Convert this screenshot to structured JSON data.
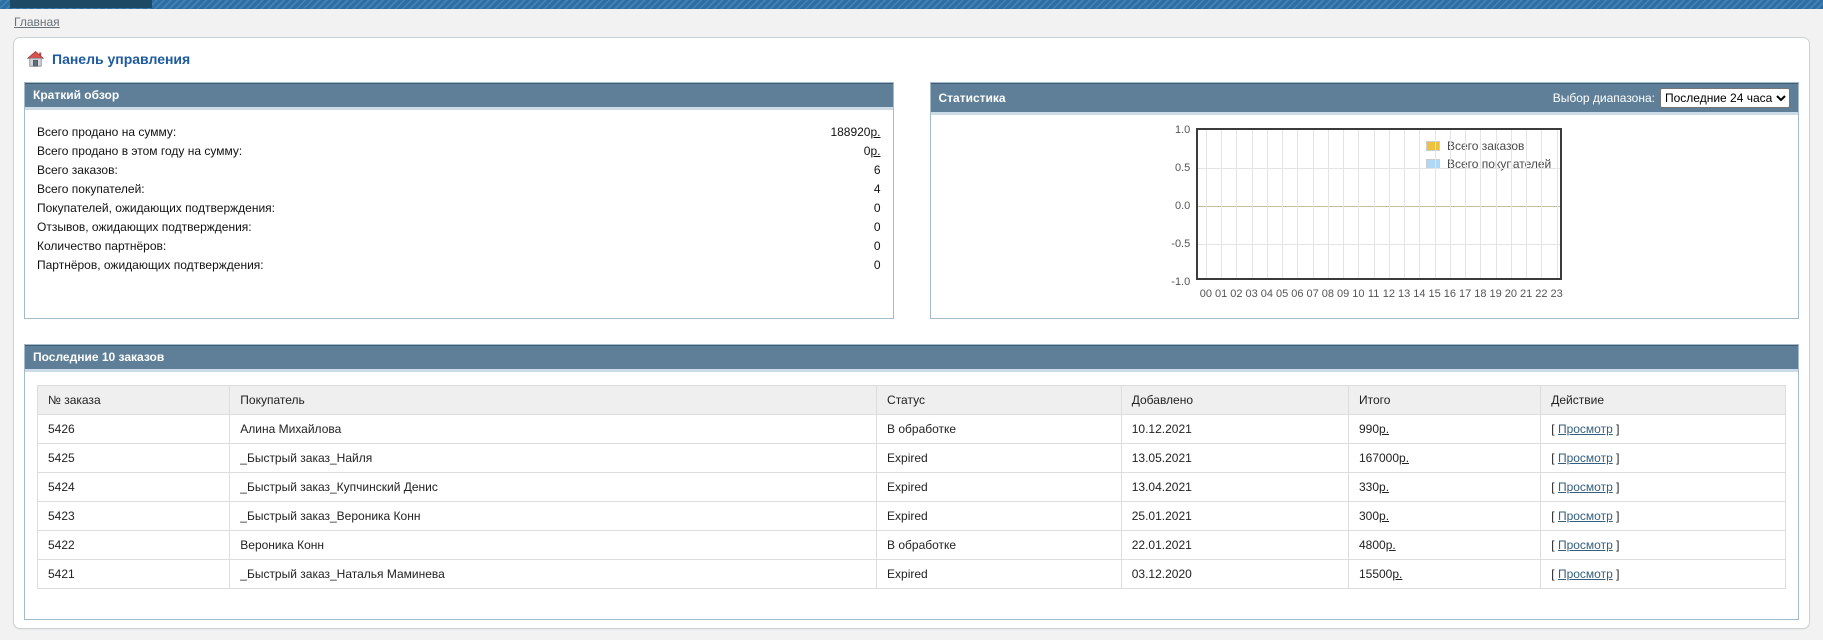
{
  "breadcrumb": {
    "home": "Главная"
  },
  "page": {
    "title": "Панель управления"
  },
  "overview": {
    "title": "Краткий обзор",
    "rows": [
      {
        "label": "Всего продано на сумму:",
        "amount": "188920",
        "currency": "р."
      },
      {
        "label": "Всего продано в этом году на сумму:",
        "amount": "0",
        "currency": "р."
      },
      {
        "label": "Всего заказов:",
        "amount": "6",
        "currency": ""
      },
      {
        "label": "Всего покупателей:",
        "amount": "4",
        "currency": ""
      },
      {
        "label": "Покупателей, ожидающих подтверждения:",
        "amount": "0",
        "currency": ""
      },
      {
        "label": "Отзывов, ожидающих подтверждения:",
        "amount": "0",
        "currency": ""
      },
      {
        "label": "Количество партнёров:",
        "amount": "0",
        "currency": ""
      },
      {
        "label": "Партнёров, ожидающих подтверждения:",
        "amount": "0",
        "currency": ""
      }
    ]
  },
  "statistics": {
    "title": "Статистика",
    "range_label": "Выбор диапазона:",
    "range_value": "Последние 24 часа"
  },
  "chart_data": {
    "type": "bar",
    "title": "",
    "xlabel": "",
    "ylabel": "",
    "x_ticks": [
      "00",
      "01",
      "02",
      "03",
      "04",
      "05",
      "06",
      "07",
      "08",
      "09",
      "10",
      "11",
      "12",
      "13",
      "14",
      "15",
      "16",
      "17",
      "18",
      "19",
      "20",
      "21",
      "22",
      "23"
    ],
    "y_ticks": [
      "1.0",
      "0.5",
      "0.0",
      "-0.5",
      "-1.0"
    ],
    "ylim": [
      -1.0,
      1.0
    ],
    "grid": true,
    "legend_position": "top-right",
    "series": [
      {
        "name": "Всего заказов",
        "color": "#EDC240",
        "values": []
      },
      {
        "name": "Всего покупателей",
        "color": "#AFD8F8",
        "values": []
      }
    ]
  },
  "orders": {
    "title": "Последние 10 заказов",
    "columns": {
      "id": "№ заказа",
      "customer": "Покупатель",
      "status": "Статус",
      "added": "Добавлено",
      "total": "Итого",
      "action": "Действие"
    },
    "action_open": "[",
    "action_close": "]",
    "rows": [
      {
        "id": "5426",
        "customer": "Алина Михайлова",
        "status": "В обработке",
        "added": "10.12.2021",
        "amount": "990",
        "currency": "р.",
        "action": "Просмотр"
      },
      {
        "id": "5425",
        "customer": "_Быстрый заказ_Найля",
        "status": "Expired",
        "added": "13.05.2021",
        "amount": "167000",
        "currency": "р.",
        "action": "Просмотр"
      },
      {
        "id": "5424",
        "customer": "_Быстрый заказ_Купчинский Денис",
        "status": "Expired",
        "added": "13.04.2021",
        "amount": "330",
        "currency": "р.",
        "action": "Просмотр"
      },
      {
        "id": "5423",
        "customer": "_Быстрый заказ_Вероника Конн",
        "status": "Expired",
        "added": "25.01.2021",
        "amount": "300",
        "currency": "р.",
        "action": "Просмотр"
      },
      {
        "id": "5422",
        "customer": "Вероника Конн",
        "status": "В обработке",
        "added": "22.01.2021",
        "amount": "4800",
        "currency": "р.",
        "action": "Просмотр"
      },
      {
        "id": "5421",
        "customer": "_Быстрый заказ_Наталья Маминева",
        "status": "Expired",
        "added": "03.12.2020",
        "amount": "15500",
        "currency": "р.",
        "action": "Просмотр"
      }
    ]
  },
  "colors": {
    "topbar": "#2e74ab",
    "topbar_block": "#1d4965",
    "panel_header": "#5e7f97",
    "title_blue": "#1d5a9e",
    "link": "#355e7e",
    "series_orders": "#EDC240",
    "series_customers": "#AFD8F8"
  }
}
